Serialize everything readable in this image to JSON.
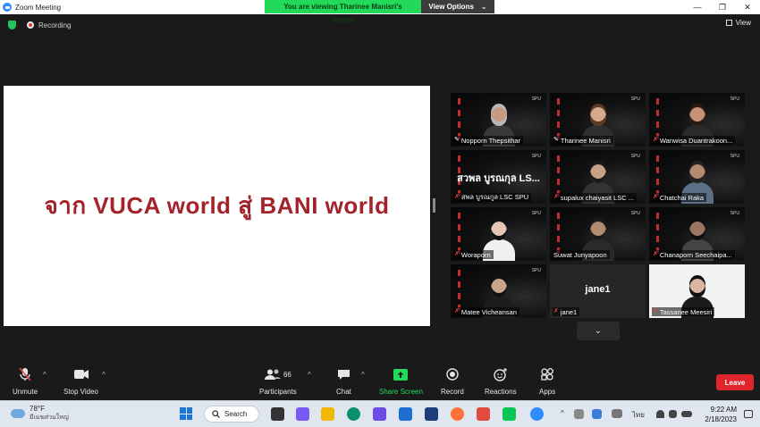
{
  "window": {
    "title": "Zoom Meeting",
    "minimize": "—",
    "maximize": "❐",
    "close": "✕"
  },
  "banner": {
    "message": "You are viewing Tharinee Manisri's screen",
    "view_options": "View Options",
    "caret": "⌄"
  },
  "status": {
    "recording": "Recording",
    "view": "View"
  },
  "slide": {
    "text": "จาก VUCA world สู่ BANI world"
  },
  "participants": [
    {
      "name": "Nopporn Thepsithar",
      "active": true,
      "pinned": true,
      "muted": false
    },
    {
      "name": "Tharinee Manisri",
      "active": false,
      "pinned": true,
      "muted": false
    },
    {
      "name": "Wanwisa Duantrakoon...",
      "active": false,
      "pinned": false,
      "muted": true
    },
    {
      "name": "สพล บูรณกูล LSC SPU",
      "display": "สวพล บูรณกุล LS...",
      "active": false,
      "pinned": false,
      "muted": true
    },
    {
      "name": "supalux chaiyasit LSC ...",
      "active": false,
      "pinned": false,
      "muted": true
    },
    {
      "name": "Chatchai Raka",
      "active": false,
      "pinned": false,
      "muted": true
    },
    {
      "name": "Woraporn",
      "active": false,
      "pinned": false,
      "muted": true
    },
    {
      "name": "Suwat Junyapoon",
      "active": false,
      "pinned": false,
      "muted": false
    },
    {
      "name": "Chanaporn Seechaipa...",
      "active": false,
      "pinned": false,
      "muted": true
    },
    {
      "name": "Matee Vicheansan",
      "active": false,
      "pinned": false,
      "muted": true
    },
    {
      "name": "jane1",
      "display": "jane1",
      "active": false,
      "pinned": false,
      "muted": true
    },
    {
      "name": "Tassanee Meesiri",
      "active": false,
      "pinned": false,
      "muted": true
    }
  ],
  "gallery": {
    "more": "⌄"
  },
  "toolbar": {
    "unmute": "Unmute",
    "stop_video": "Stop Video",
    "participants": "Participants",
    "participants_count": "66",
    "chat": "Chat",
    "share_screen": "Share Screen",
    "record": "Record",
    "reactions": "Reactions",
    "apps": "Apps",
    "leave": "Leave",
    "caret": "^"
  },
  "taskbar": {
    "temperature": "78°F",
    "weather_desc": "มีเมฆส่วนใหญ่",
    "search": "Search",
    "language": "ไทย",
    "time": "9:22 AM",
    "date": "2/18/2023"
  },
  "colors": {
    "accent_green": "#23d959",
    "leave_red": "#e0242b",
    "slide_text": "#a3232a",
    "active_speaker": "#d8ef5a"
  }
}
